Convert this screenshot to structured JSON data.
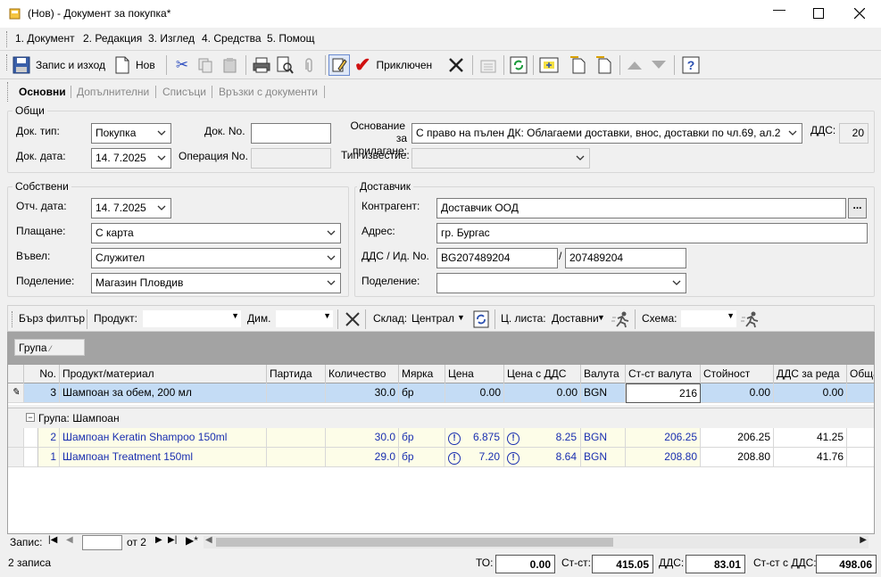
{
  "window": {
    "title": "(Нов) - Документ за покупка*"
  },
  "menu": [
    "1. Документ",
    "2. Редакция",
    "3. Изглед",
    "4. Средства",
    "5. Помощ"
  ],
  "toolbar": {
    "save_exit": "Запис и изход",
    "new": "Нов",
    "finished": "Приключен"
  },
  "tabs": [
    "Основни",
    "Допълнителни",
    "Списъци",
    "Връзки с документи"
  ],
  "general": {
    "legend": "Общи",
    "doc_type_label": "Док. тип:",
    "doc_type": "Покупка",
    "doc_no_label": "Док. No.",
    "doc_no": "",
    "doc_date_label": "Док. дата:",
    "doc_date": "14. 7.2025",
    "op_no_label": "Операция No.",
    "op_no": "",
    "basis_label_1": "Основание",
    "basis_label_2": "за прилагане:",
    "basis": "С право на пълен ДК: Облагаеми доставки, внос, доставки по чл.69, ал.2",
    "notice_label": "Тип известие:",
    "notice": "",
    "vat_label": "ДДС:",
    "vat": "20"
  },
  "own": {
    "legend": "Собствени",
    "acc_date_label": "Отч. дата:",
    "acc_date": "14. 7.2025",
    "payment_label": "Плащане:",
    "payment": "С карта",
    "entered_label": "Въвел:",
    "entered": "Служител",
    "division_label": "Поделение:",
    "division": "Магазин Пловдив"
  },
  "supplier": {
    "legend": "Доставчик",
    "partner_label": "Контрагент:",
    "partner": "Доставчик ООД",
    "browse": "...",
    "address_label": "Адрес:",
    "address": "гр. Бургас",
    "vat_id_label": "ДДС / Ид. No.",
    "vat_no": "BG207489204",
    "slash": "/",
    "id_no": "207489204",
    "division_label": "Поделение:",
    "division": ""
  },
  "filter": {
    "quick": "Бърз филтър",
    "product_label": "Продукт:",
    "product": "",
    "dim_label": "Дим.",
    "dim": "",
    "store_label": "Склад:",
    "store": "Централ",
    "price_list_label": "Ц. листа:",
    "price_list": "Доставни",
    "scheme_label": "Схема:",
    "scheme": ""
  },
  "group_area": {
    "chip": "Група",
    "sort_mark": "⁄"
  },
  "grid": {
    "columns": [
      "No.",
      "Продукт/материал",
      "Партида",
      "Количество",
      "Мярка",
      "Цена",
      "Цена с ДДС",
      "Валута",
      "Ст-ст валута",
      "Стойност",
      "ДДС за реда",
      "Обща"
    ],
    "edit_row": {
      "no": "3",
      "product": "Шампоан за обем, 200 мл",
      "batch": "",
      "qty": "30.0",
      "unit": "бр",
      "price": "0.00",
      "price_vat": "0.00",
      "currency": "BGN",
      "value_cur": "216",
      "value": "0.00",
      "vat_row": "0.00"
    },
    "group_label": "Група: Шампоан",
    "rows": [
      {
        "no": "2",
        "product": "Шампоан Keratin Shampoo 150ml",
        "batch": "",
        "qty": "30.0",
        "unit": "бр",
        "price": "6.875",
        "price_vat": "8.25",
        "currency": "BGN",
        "value_cur": "206.25",
        "value": "206.25",
        "vat_row": "41.25"
      },
      {
        "no": "1",
        "product": "Шампоан Treatment 150ml",
        "batch": "",
        "qty": "29.0",
        "unit": "бр",
        "price": "7.20",
        "price_vat": "8.64",
        "currency": "BGN",
        "value_cur": "208.80",
        "value": "208.80",
        "vat_row": "41.76"
      }
    ]
  },
  "nav": {
    "label": "Запис:",
    "current": "",
    "of": "от 2"
  },
  "status": {
    "records": "2 записа",
    "to_label": "ТО:",
    "to": "0.00",
    "cost_label": "Ст-ст:",
    "cost": "415.05",
    "vat_label": "ДДС:",
    "vat": "83.01",
    "cost_vat_label": "Ст-ст с ДДС:",
    "cost_vat": "498.06"
  },
  "colors": {
    "selected_row": "#c4dcf5",
    "group_rows": "#fdfde8",
    "link_text": "#1a2fb0",
    "group_area": "#a3a3a3"
  }
}
